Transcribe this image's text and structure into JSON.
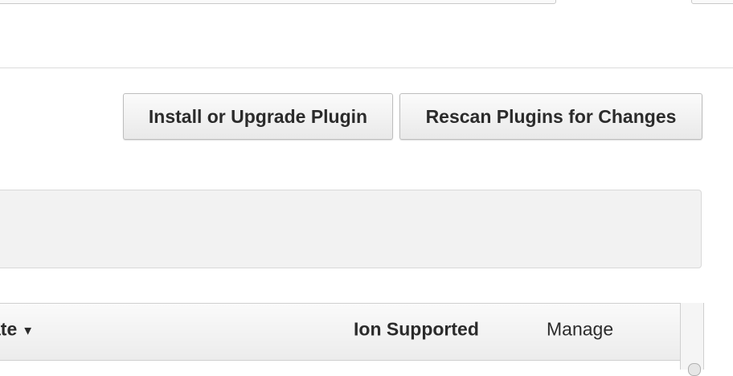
{
  "toolbar": {
    "install_label": "Install or Upgrade Plugin",
    "rescan_label": "Rescan Plugins for Changes"
  },
  "table": {
    "columns": {
      "date": "ate",
      "ion_supported": "Ion Supported",
      "manage": "Manage"
    },
    "sort_icon": "▼"
  },
  "icons": {
    "sort": "sort-descending-icon"
  }
}
